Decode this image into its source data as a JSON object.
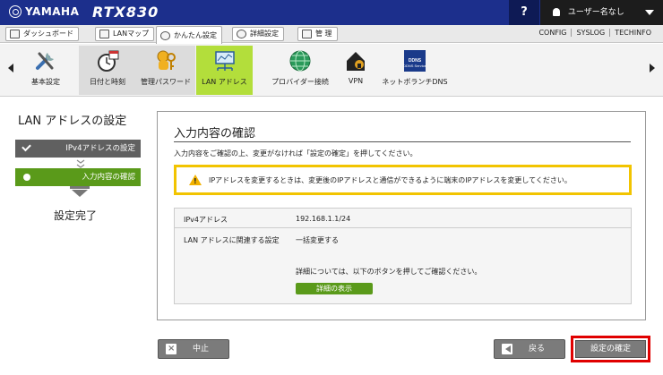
{
  "header": {
    "brand": "YAMAHA",
    "model": "RTX830",
    "help": "?",
    "user": "ユーザー名なし"
  },
  "menu": {
    "tabs": [
      {
        "label": "ダッシュボード",
        "icon": "dashboard-icon"
      },
      {
        "label": "LANマップ",
        "icon": "lan-map-icon"
      },
      {
        "label": "かんたん設定",
        "icon": "wizard-icon",
        "active": true
      },
      {
        "label": "詳細設定",
        "icon": "gear-icon"
      },
      {
        "label": "管 理",
        "icon": "wrench-icon"
      }
    ],
    "links": [
      "CONFIG",
      "SYSLOG",
      "TECHINFO"
    ]
  },
  "toolbar": {
    "items": [
      {
        "label": "基本設定",
        "icon": "basic-settings-icon"
      },
      {
        "label": "日付と時刻",
        "icon": "clock-icon"
      },
      {
        "label": "管理パスワード",
        "icon": "password-key-icon"
      },
      {
        "label": "LAN アドレス",
        "icon": "lan-address-icon",
        "selected": true
      },
      {
        "label": "プロバイダー接続",
        "icon": "globe-icon"
      },
      {
        "label": "VPN",
        "icon": "vpn-icon"
      },
      {
        "label": "ネットボランチDNS",
        "icon": "ddns-icon",
        "sub": "DDNS Service"
      }
    ]
  },
  "stepper": {
    "title": "LAN アドレスの設定",
    "steps": [
      {
        "label": "IPv4アドレスの設定",
        "state": "done"
      },
      {
        "label": "入力内容の確認",
        "state": "current"
      }
    ],
    "final": "設定完了"
  },
  "panel": {
    "title": "入力内容の確認",
    "instruction": "入力内容をご確認の上、変更がなければ「設定の確定」を押してください。",
    "warning": "IPアドレスを変更するときは、変更後のIPアドレスと通信ができるように端末のIPアドレスを変更してください。",
    "rows": [
      {
        "label": "IPv4アドレス",
        "value": "192.168.1.1/24"
      },
      {
        "label": "LAN アドレスに関連する設定",
        "value": "一括変更する",
        "note": "詳細については、以下のボタンを押してご確認ください。"
      }
    ],
    "detail_button": "詳細の表示"
  },
  "buttons": {
    "cancel": "中止",
    "back": "戻る",
    "confirm": "設定の確定"
  },
  "colors": {
    "header_bg": "#1c2f8c",
    "accent_green": "#b3de3b",
    "step_dark": "#606060",
    "step_current": "#5a9a1a",
    "warning_border": "#f2c400",
    "highlight_red": "#e00000"
  }
}
